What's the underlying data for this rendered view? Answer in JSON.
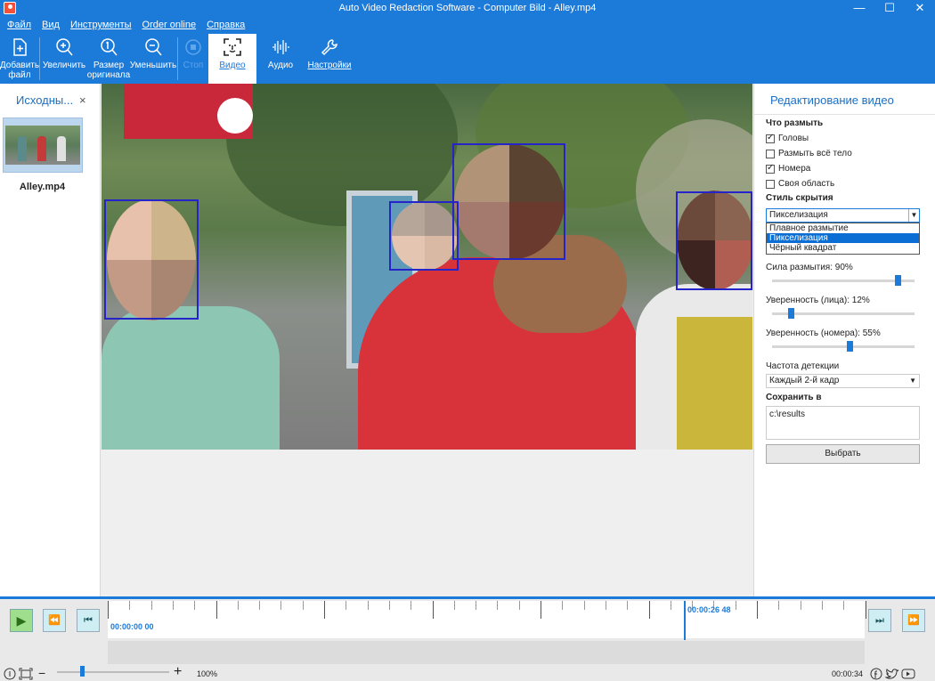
{
  "window": {
    "title": "Auto Video Redaction Software - Computer Bild"
  },
  "window_buttons": {
    "minimize": "—",
    "maximize": "☐",
    "close": "✕"
  },
  "menu": [
    "Файл",
    "Вид",
    "Инструменты",
    "Order online",
    "Справка"
  ],
  "ribbon": {
    "add_file": [
      "Добавить",
      "файл"
    ],
    "zoom_in": "Увеличить",
    "original_size": [
      "Размер",
      "оригинала"
    ],
    "zoom_out": "Уменьшить",
    "stop": "Стоп",
    "video": "Видео",
    "audio": "Аудио",
    "settings": "Настройки"
  },
  "left_panel": {
    "title": "Исходны...",
    "close": "×",
    "file_name": "Alley.mp4"
  },
  "right_panel": {
    "title": "Редактирование видео",
    "what_to_blur": "Что размыть",
    "checkboxes": [
      {
        "label": "Головы",
        "checked": true
      },
      {
        "label": "Размыть всё тело",
        "checked": false
      },
      {
        "label": "Номера",
        "checked": true
      },
      {
        "label": "Своя область",
        "checked": false
      }
    ],
    "hide_style_label": "Стиль скрытия",
    "hide_style_value": "Пикселизация",
    "hide_style_options": [
      "Плавное размытие",
      "Пикселизация",
      "Чёрный квадрат"
    ],
    "hide_style_selected_index": 1,
    "blur_strength_label": "Сила размытия: 90%",
    "blur_strength": 0.9,
    "face_confidence_label": "Уверенность (лица): 12%",
    "face_confidence": 0.12,
    "plate_confidence_label": "Уверенность (номера): 55%",
    "plate_confidence": 0.55,
    "detect_freq_label": "Частота детекции",
    "detect_freq_value": "Каждый 2-й кадр",
    "save_to_label": "Сохранить в",
    "save_path": "c:\\results",
    "choose_button": "Выбрать"
  },
  "timeline": {
    "start_time": "00:00:00 00",
    "current_time": "00:00:26 48",
    "total_time": "00:00:34",
    "zoom_level": "100%"
  },
  "colors": {
    "accent": "#1c7ad8",
    "bbox": "#2424c8"
  }
}
